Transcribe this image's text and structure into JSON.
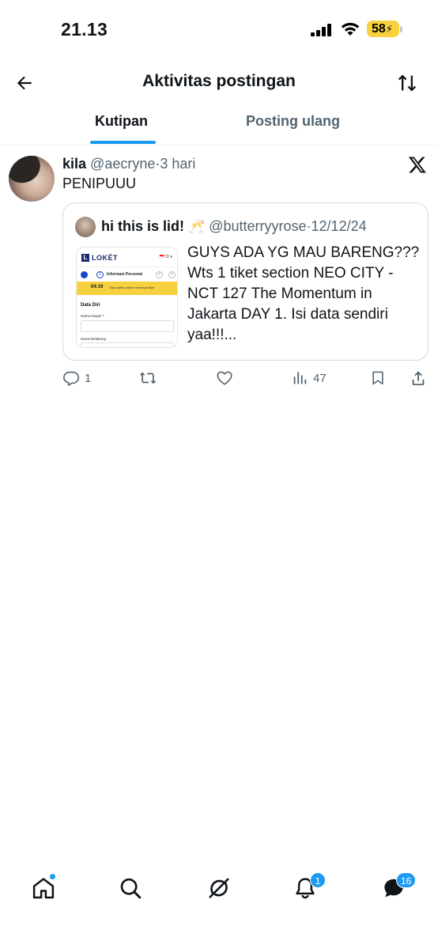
{
  "status_bar": {
    "time": "21.13",
    "battery": "58",
    "battery_color": "#f7d23e"
  },
  "header": {
    "title": "Aktivitas postingan",
    "back_icon": "arrow-left-icon",
    "sort_icon": "sort-arrows-icon"
  },
  "tabs": [
    {
      "label": "Kutipan",
      "active": true
    },
    {
      "label": "Posting ulang",
      "active": false
    }
  ],
  "post": {
    "display_name": "kila",
    "handle": "@aecryne",
    "separator": "·",
    "time": "3 hari",
    "text": "PENIPUUU",
    "quote": {
      "display_name": "hi this is lid!",
      "emoji": "🥂",
      "handle": "@butterryyrose",
      "separator": "·",
      "date": "12/12/24",
      "text": "GUYS ADA YG MAU BARENG??? Wts 1 tiket section NEO CITY - NCT 127 The Momentum in Jakarta DAY 1. Isi data sendiri yaa!!!...",
      "thumbnail": {
        "logo_mark": "L",
        "logo_text": "LOKÉT",
        "lang": "🇮🇩 ID ▾",
        "step_number": "2",
        "step_label": "Informasi Personal",
        "step_3": "3",
        "step_4": "4",
        "timer": "04:19",
        "timer_note": "Sisa waktu untuk memesan tiket",
        "section_title": "Data Diri",
        "field_1_label": "Nama Depan *",
        "field_2_label": "Nama Belakang"
      }
    },
    "actions": {
      "replies": "1",
      "views": "47"
    }
  },
  "bottom_nav": {
    "items": [
      "home-icon",
      "search-icon",
      "grok-icon",
      "bell-icon",
      "messages-icon"
    ],
    "notifications_badge": "1",
    "messages_badge": "16",
    "accent": "#1d9bf0"
  }
}
